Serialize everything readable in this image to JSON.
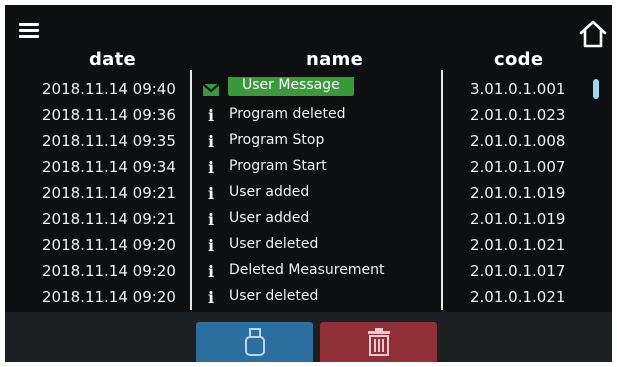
{
  "header": {
    "date": "date",
    "name": "name",
    "code": "code"
  },
  "rows": [
    {
      "date": "2018.11.14  09:40",
      "icon": "envelope-icon",
      "name": "User Message",
      "code": "3.01.0.1.001",
      "selected": true
    },
    {
      "date": "2018.11.14  09:36",
      "icon": "info-icon",
      "name": "Program deleted",
      "code": "2.01.0.1.023"
    },
    {
      "date": "2018.11.14  09:35",
      "icon": "info-icon",
      "name": "Program Stop",
      "code": "2.01.0.1.008"
    },
    {
      "date": "2018.11.14  09:34",
      "icon": "info-icon",
      "name": "Program Start",
      "code": "2.01.0.1.007"
    },
    {
      "date": "2018.11.14  09:21",
      "icon": "info-icon",
      "name": "User added",
      "code": "2.01.0.1.019"
    },
    {
      "date": "2018.11.14  09:21",
      "icon": "info-icon",
      "name": "User added",
      "code": "2.01.0.1.019"
    },
    {
      "date": "2018.11.14  09:20",
      "icon": "info-icon",
      "name": "User deleted",
      "code": "2.01.0.1.021"
    },
    {
      "date": "2018.11.14  09:20",
      "icon": "info-icon",
      "name": "Deleted Measurement",
      "code": "2.01.0.1.017"
    },
    {
      "date": "2018.11.14  09:20",
      "icon": "info-icon",
      "name": "User deleted",
      "code": "2.01.0.1.021"
    }
  ],
  "icons": {
    "info_glyph": "i"
  },
  "colors": {
    "background": "#0d0f10",
    "selected": "#3a9a3b",
    "usb_button": "#2a6f9e",
    "delete_button": "#8f2f38",
    "scrollbar": "#9fd8f3"
  }
}
